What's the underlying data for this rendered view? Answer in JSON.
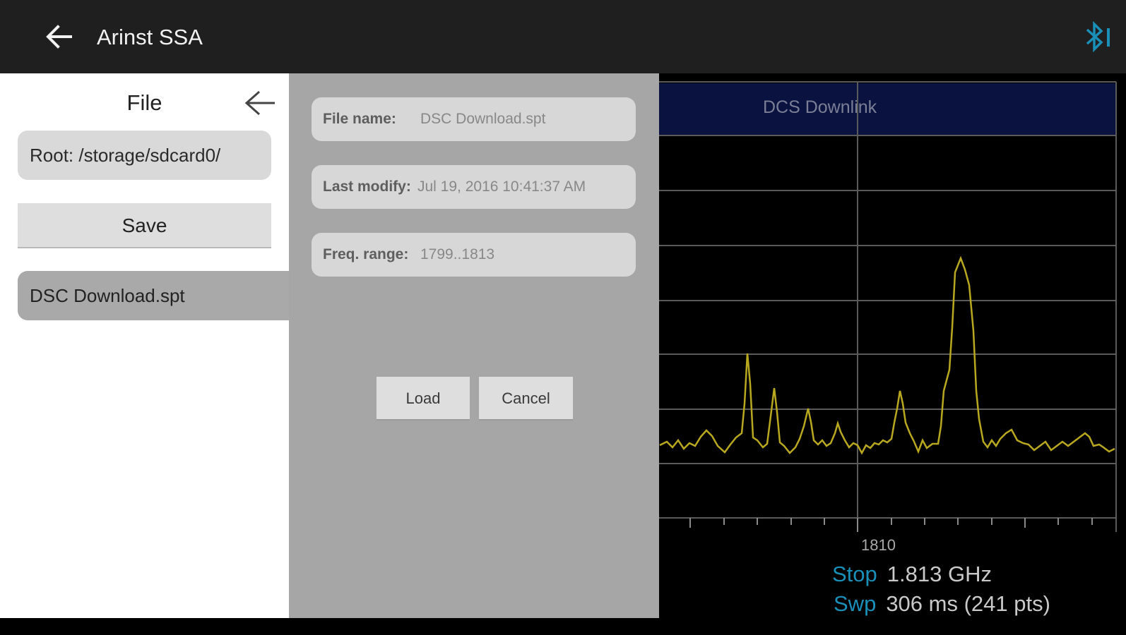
{
  "header": {
    "title": "Arinst SSA",
    "bluetooth_icon": "bluetooth-icon",
    "accent": "#1a8fb8"
  },
  "file_panel": {
    "title": "File",
    "root_label": "Root: /storage/sdcard0/",
    "save_label": "Save",
    "files": [
      "DSC Download.spt"
    ]
  },
  "details": {
    "file_name_label": "File name:",
    "file_name_value": "DSC Download.spt",
    "last_modify_label": "Last modify:",
    "last_modify_value": "Jul 19, 2016 10:41:37 AM",
    "freq_range_label": "Freq. range:",
    "freq_range_value": "1799..1813",
    "load_label": "Load",
    "cancel_label": "Cancel"
  },
  "spectrum": {
    "band_name": "DCS Downlink",
    "tick_label": "1810",
    "stop_key": "Stop",
    "stop_value": "1.813 GHz",
    "swp_key": "Swp",
    "swp_value": "306 ms (241 pts)",
    "trace_color": "#b8a820"
  }
}
